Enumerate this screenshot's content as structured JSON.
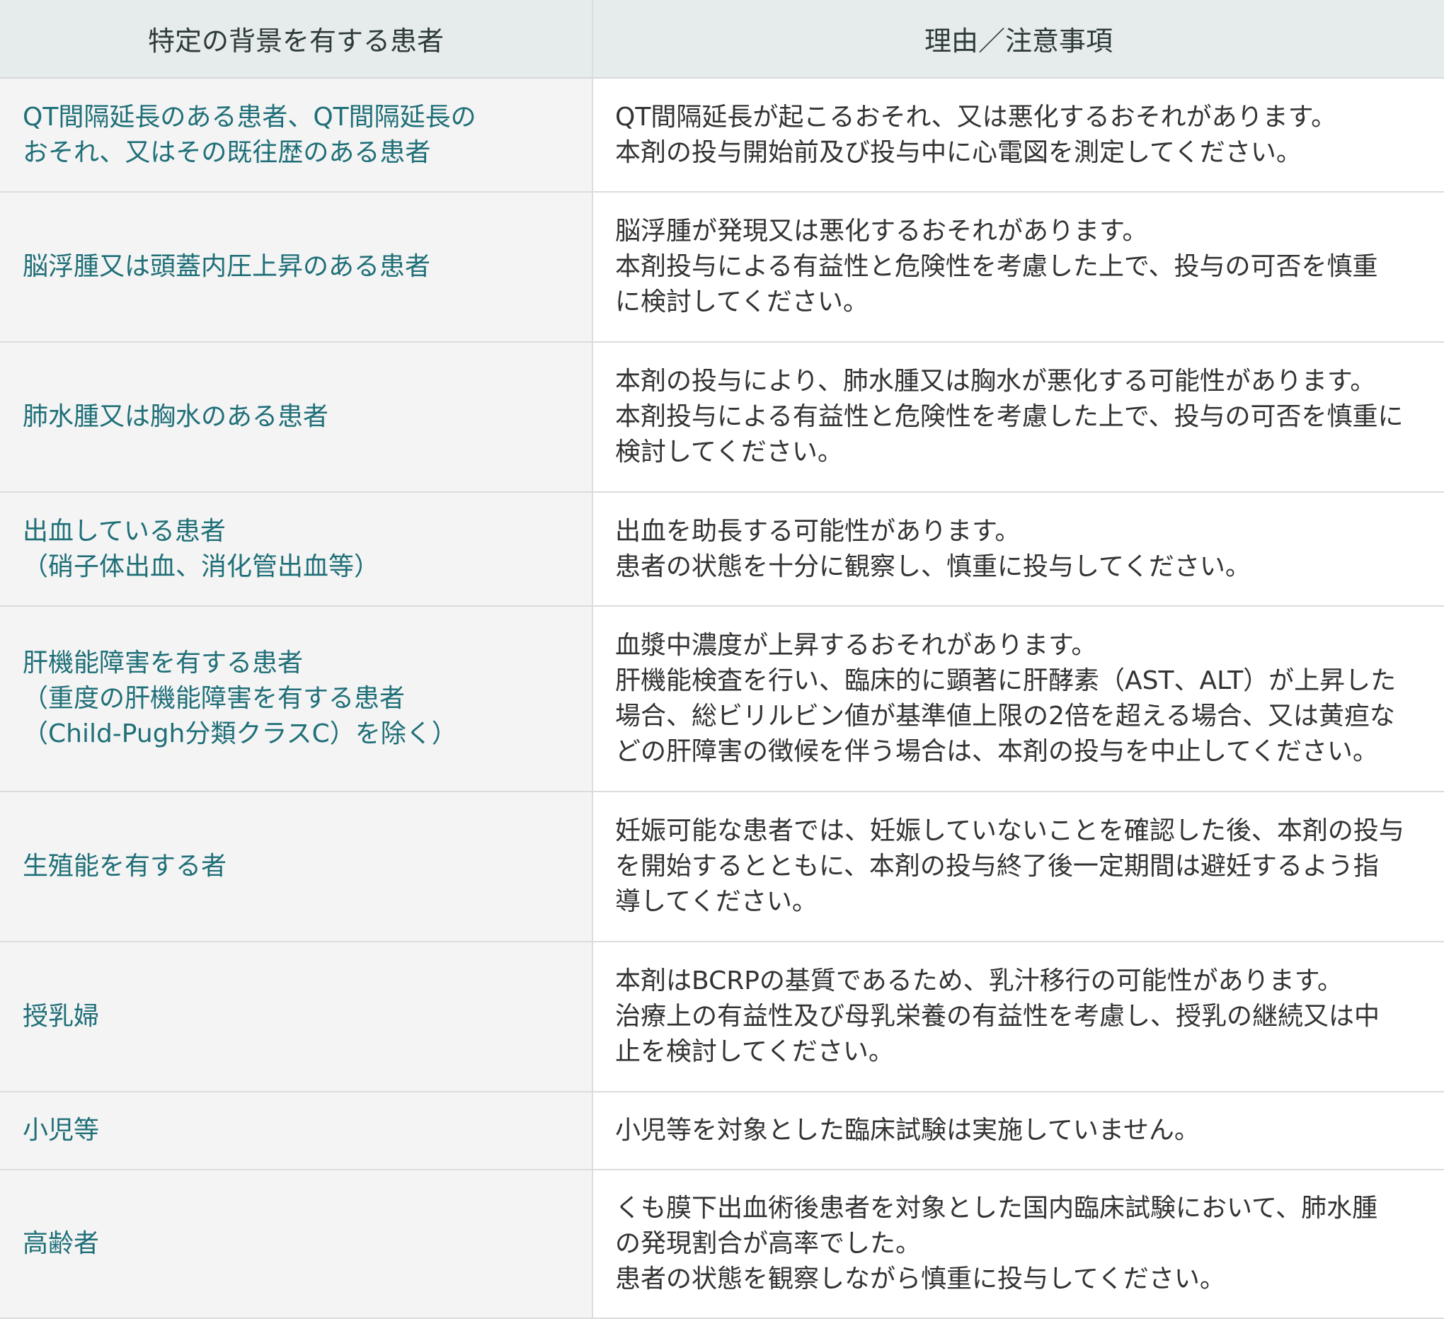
{
  "header": {
    "col1": "特定の背景を有する患者",
    "col2": "理由／注意事項"
  },
  "rows": [
    {
      "background": [
        "QT間隔延長のある患者、QT間隔延長の",
        "おそれ、又はその既往歴のある患者"
      ],
      "reason": [
        "QT間隔延長が起こるおそれ、又は悪化するおそれがあります。",
        "本剤の投与開始前及び投与中に心電図を測定してください。"
      ]
    },
    {
      "background": [
        "脳浮腫又は頭蓋内圧上昇のある患者"
      ],
      "reason": [
        "脳浮腫が発現又は悪化するおそれがあります。",
        "本剤投与による有益性と危険性を考慮した上で、投与の可否を慎重",
        "に検討してください。"
      ]
    },
    {
      "background": [
        "肺水腫又は胸水のある患者"
      ],
      "reason": [
        "本剤の投与により、肺水腫又は胸水が悪化する可能性があります。",
        "本剤投与による有益性と危険性を考慮した上で、投与の可否を慎重に",
        "検討してください。"
      ]
    },
    {
      "background": [
        "出血している患者",
        "（硝子体出血、消化管出血等）"
      ],
      "reason": [
        "出血を助長する可能性があります。",
        "患者の状態を十分に観察し、慎重に投与してください。"
      ]
    },
    {
      "background": [
        "肝機能障害を有する患者",
        "（重度の肝機能障害を有する患者",
        "（Child-Pugh分類クラスC）を除く）"
      ],
      "reason": [
        "血漿中濃度が上昇するおそれがあります。",
        "肝機能検査を行い、臨床的に顕著に肝酵素（AST、ALT）が上昇した",
        "場合、総ビリルビン値が基準値上限の2倍を超える場合、又は黄疸な",
        "どの肝障害の徴候を伴う場合は、本剤の投与を中止してください。"
      ]
    },
    {
      "background": [
        "生殖能を有する者"
      ],
      "reason": [
        "妊娠可能な患者では、妊娠していないことを確認した後、本剤の投与",
        "を開始するとともに、本剤の投与終了後一定期間は避妊するよう指",
        "導してください。"
      ]
    },
    {
      "background": [
        "授乳婦"
      ],
      "reason": [
        "本剤はBCRPの基質であるため、乳汁移行の可能性があります。",
        "治療上の有益性及び母乳栄養の有益性を考慮し、授乳の継続又は中",
        "止を検討してください。"
      ]
    },
    {
      "background": [
        "小児等"
      ],
      "reason": [
        "小児等を対象とした臨床試験は実施していません。"
      ]
    },
    {
      "background": [
        "高齢者"
      ],
      "reason": [
        "くも膜下出血術後患者を対象とした国内臨床試験において、肺水腫",
        "の発現割合が高率でした。",
        "患者の状態を観察しながら慎重に投与してください。"
      ]
    }
  ]
}
